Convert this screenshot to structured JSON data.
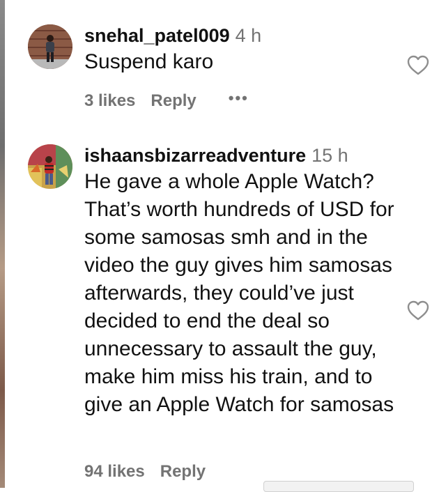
{
  "comments": [
    {
      "username": "snehal_patel009",
      "time": "4 h",
      "text": "Suspend karo",
      "likes": "3 likes",
      "reply_label": "Reply",
      "more_label": "•••"
    },
    {
      "username": "ishaansbizarreadventure",
      "time": "15 h",
      "text": "He gave a whole Apple Watch? That’s worth hundreds of USD for some samosas smh and in the video the guy gives him samosas afterwards, they could’ve just decided to end the deal so unnecessary to assault the guy, make him miss his train, and to give an Apple Watch for samosas",
      "likes": "94 likes",
      "reply_label": "Reply"
    }
  ],
  "icons": {
    "like": "heart-outline-icon",
    "more": "more-options-icon"
  }
}
